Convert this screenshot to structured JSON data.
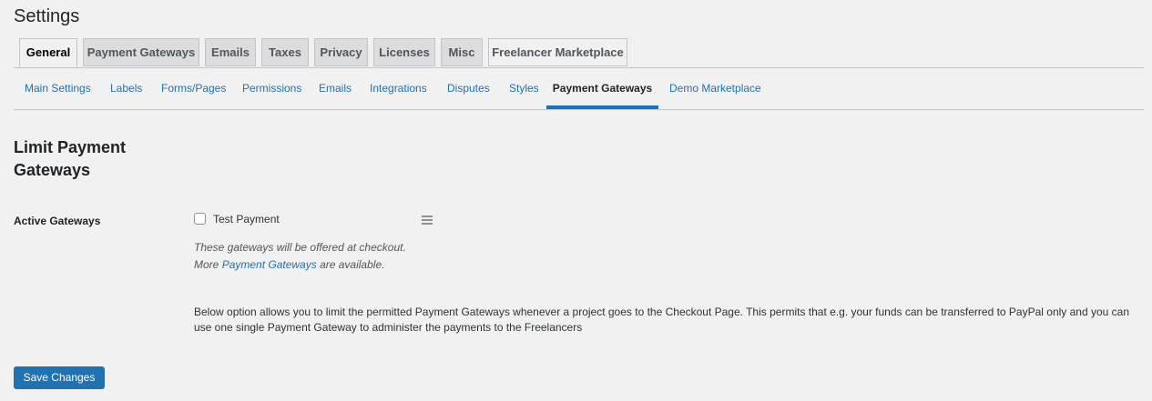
{
  "header": {
    "title": "Settings"
  },
  "main_tabs": [
    {
      "label": "General",
      "active": true
    },
    {
      "label": "Payment Gateways",
      "active": false
    },
    {
      "label": "Emails",
      "active": false
    },
    {
      "label": "Taxes",
      "active": false
    },
    {
      "label": "Privacy",
      "active": false
    },
    {
      "label": "Licenses",
      "active": false
    },
    {
      "label": "Misc",
      "active": false
    },
    {
      "label": "Freelancer Marketplace",
      "active": false
    }
  ],
  "sub_tabs": [
    {
      "label": "Main Settings",
      "active": false
    },
    {
      "label": "Labels",
      "active": false
    },
    {
      "label": "Forms/Pages",
      "active": false
    },
    {
      "label": "Permissions",
      "active": false
    },
    {
      "label": "Emails",
      "active": false
    },
    {
      "label": "Integrations",
      "active": false
    },
    {
      "label": "Disputes",
      "active": false
    },
    {
      "label": "Styles",
      "active": false
    },
    {
      "label": "Payment Gateways",
      "active": true
    },
    {
      "label": "Demo Marketplace",
      "active": false
    }
  ],
  "section": {
    "title": "Limit Payment Gateways"
  },
  "gateways": {
    "label": "Active Gateways",
    "items": [
      {
        "label": "Test Payment",
        "checked": false
      }
    ],
    "desc_line1": "These gateways will be offered at checkout.",
    "desc_more": "More",
    "desc_link": "Payment Gateways",
    "desc_tail": "are available."
  },
  "info": {
    "text": "Below option allows you to limit the permitted Payment Gateways whenever a project goes to the Checkout Page. This permits that e.g. your funds can be transferred to PayPal only and you can use one single Payment Gateway to administer the payments to the Freelancers"
  },
  "actions": {
    "save_label": "Save Changes"
  },
  "colors": {
    "accent": "#2271b1",
    "background": "#f1f1f1",
    "tab_inactive": "#dcdcde"
  },
  "icons": {
    "drag": "menu-icon"
  }
}
